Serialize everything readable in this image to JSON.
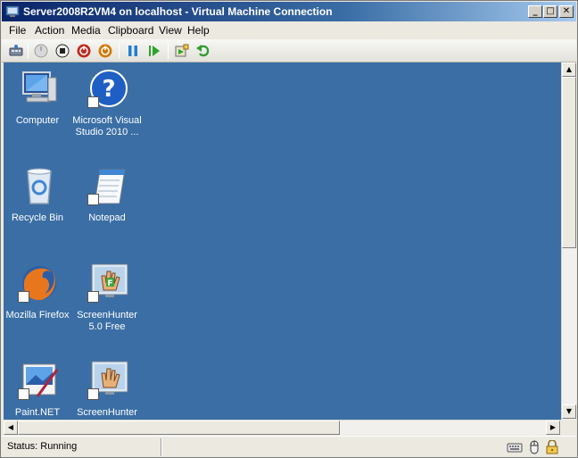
{
  "window": {
    "title": "Server2008R2VM4 on localhost - Virtual Machine Connection",
    "minimize": "_",
    "maximize": "□",
    "close": "✕"
  },
  "menu": [
    "File",
    "Action",
    "Media",
    "Clipboard",
    "View",
    "Help"
  ],
  "toolbar": {
    "buttons": [
      "ctrl-alt-del-icon",
      "start-icon",
      "turn-off-icon",
      "shut-down-icon",
      "save-icon",
      "pause-icon",
      "resume-icon",
      "snapshot-icon",
      "revert-icon"
    ],
    "colors": {
      "stop": "#222222",
      "shutdown": "#c0281e",
      "save": "#d27a0a",
      "pause": "#1f7fd0",
      "resume": "#2aa52a",
      "revert": "#2e9e2e"
    }
  },
  "desktop": {
    "background": "#3a6ea5",
    "icons": [
      {
        "label": "Computer",
        "icon": "computer-icon",
        "shortcut": false
      },
      {
        "label": "Microsoft Visual Studio 2010 ...",
        "icon": "help-icon",
        "shortcut": true
      },
      {
        "label": "Recycle Bin",
        "icon": "recycle-bin-icon",
        "shortcut": false
      },
      {
        "label": "Notepad",
        "icon": "notepad-icon",
        "shortcut": true
      },
      {
        "label": "Mozilla Firefox",
        "icon": "firefox-icon",
        "shortcut": true
      },
      {
        "label": "ScreenHunter 5.0 Free",
        "icon": "screenhunter-free-icon",
        "shortcut": true
      },
      {
        "label": "Paint.NET",
        "icon": "paint-net-icon",
        "shortcut": true
      },
      {
        "label": "ScreenHunter",
        "icon": "screenhunter-icon",
        "shortcut": true
      }
    ]
  },
  "status": {
    "text": "Status: Running",
    "icons": [
      "keyboard-icon",
      "mouse-icon",
      "lock-icon"
    ]
  }
}
